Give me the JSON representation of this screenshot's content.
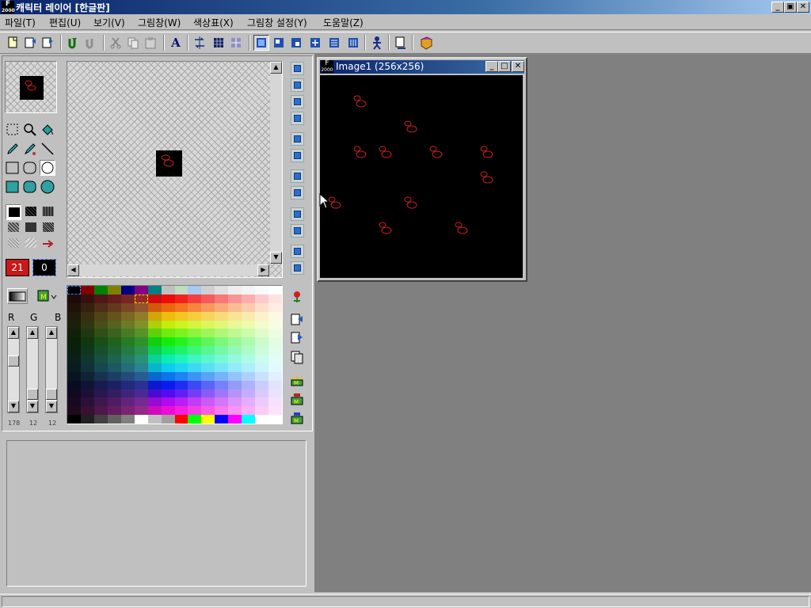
{
  "app": {
    "title": "캐릭터 레이어 [한글판]",
    "icon_text_top": "F",
    "icon_text_bottom": "2000"
  },
  "window_controls": {
    "minimize": "_",
    "restore": "▣",
    "close": "✕"
  },
  "menu": [
    {
      "label": "파일(T)"
    },
    {
      "label": "편집(U)"
    },
    {
      "label": "보기(V)"
    },
    {
      "label": "그림창(W)"
    },
    {
      "label": "색상표(X)"
    },
    {
      "label": "그림창 설정(Y)"
    },
    {
      "label": "도움말(Z)"
    }
  ],
  "toolbar": {
    "icons": [
      "new-icon",
      "open-icon",
      "save-icon",
      "undo-icon",
      "redo-icon",
      "cut-icon",
      "copy-icon",
      "paste-icon",
      "text-icon",
      "flip-icon",
      "grid-icon",
      "grid2-icon",
      "view1-icon",
      "view2-icon",
      "view3-icon",
      "view4-icon",
      "view5-icon",
      "view6-icon",
      "character-icon",
      "preview-icon",
      "book-icon"
    ],
    "text_button": "A"
  },
  "colors": {
    "accent": "#0a246a",
    "canvas_bg": "#000000",
    "sprite_stroke": "#d02020",
    "fg_color": "#c81818",
    "bg_color": "#000000",
    "mdi_bg": "#808080"
  },
  "color_indices": {
    "foreground": "21",
    "background": "0"
  },
  "rgb": {
    "labels": [
      "R",
      "G",
      "B"
    ],
    "values": [
      "178",
      "12",
      "12"
    ]
  },
  "image_window": {
    "title": "Image1 (256x256)",
    "icon_text_top": "F",
    "icon_text_bottom": "2000"
  },
  "sprites_count_note": "",
  "status": {
    "text": ""
  }
}
